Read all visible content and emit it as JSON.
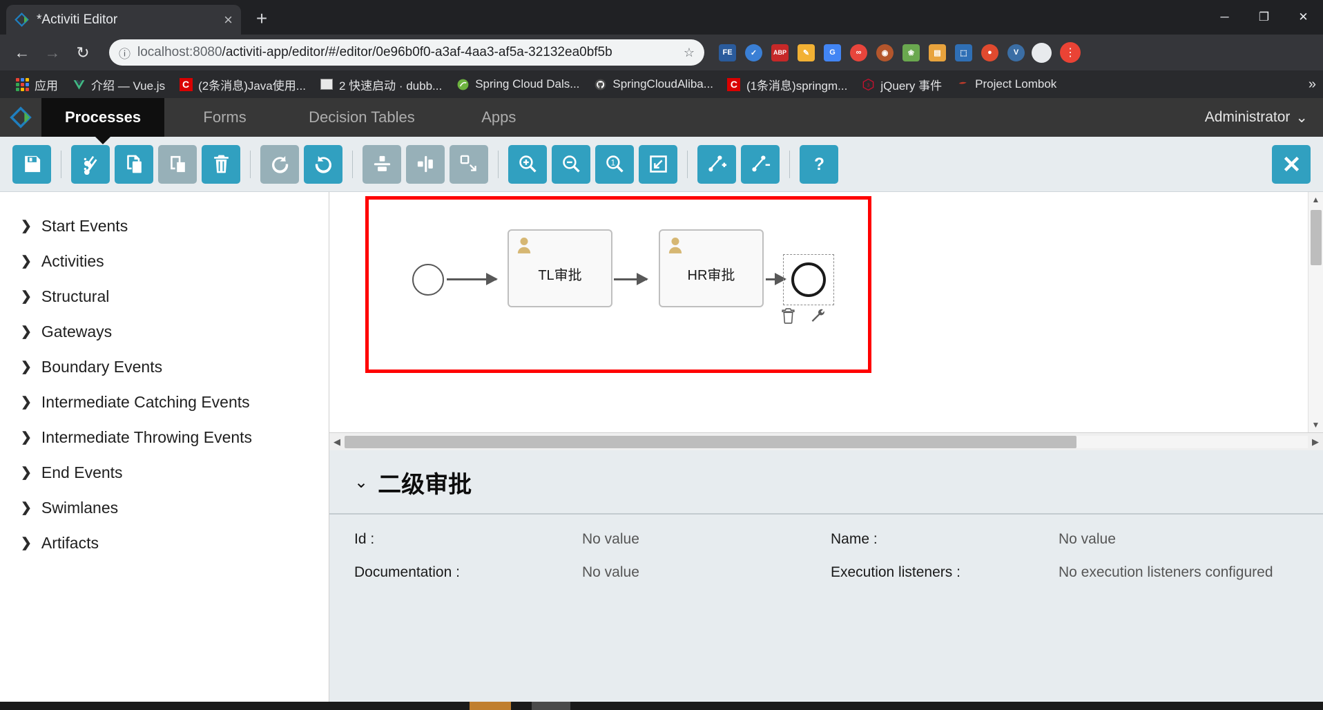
{
  "browser": {
    "tab": {
      "title": "*Activiti Editor",
      "favicon": "activiti-diamond-icon",
      "close": "×"
    },
    "newtab_label": "+",
    "window_controls": {
      "minimize": "─",
      "maximize": "❐",
      "close": "✕"
    },
    "nav": {
      "back": "←",
      "forward": "→",
      "reload": "↻"
    },
    "omnibox": {
      "info_icon": "ⓘ",
      "url_host": "localhost:8080",
      "url_path": "/activiti-app/editor/#/editor/0e96b0f0-a3af-4aa3-af5a-32132ea0bf5b",
      "star": "☆"
    },
    "extensions": [
      {
        "name": "fe-extension",
        "label": "FE",
        "color": "#2a5b9c"
      },
      {
        "name": "check-extension",
        "label": "✓",
        "color": "#3a7fd5"
      },
      {
        "name": "adblock-plus-extension",
        "label": "ABP",
        "color": "#c62828"
      },
      {
        "name": "notes-extension",
        "label": "✎",
        "color": "#f2b134"
      },
      {
        "name": "google-translate-extension",
        "label": "G",
        "color": "#4285f4"
      },
      {
        "name": "infinity-extension",
        "label": "∞",
        "color": "#e8453c"
      },
      {
        "name": "monkey-extension",
        "label": "◉",
        "color": "#b4562c"
      },
      {
        "name": "leaf-extension",
        "label": "❀",
        "color": "#6aa84f"
      },
      {
        "name": "box-extension",
        "label": "▤",
        "color": "#e8a33d"
      },
      {
        "name": "dashboard-extension",
        "label": "⬚",
        "color": "#2f6fb5"
      },
      {
        "name": "circle-extension",
        "label": "●",
        "color": "#e04a2f"
      },
      {
        "name": "v-extension",
        "label": "V",
        "color": "#3b6ea5"
      }
    ],
    "bookmarks": [
      {
        "label": "应用",
        "icon": "apps-grid-icon"
      },
      {
        "label": "介绍 — Vue.js",
        "icon": "vue-icon"
      },
      {
        "label": "(2条消息)Java使用...",
        "icon": "csdn-icon"
      },
      {
        "label": "2 快速启动 · dubb...",
        "icon": "book-icon"
      },
      {
        "label": "Spring Cloud Dals...",
        "icon": "spring-icon"
      },
      {
        "label": "SpringCloudAliba...",
        "icon": "github-icon"
      },
      {
        "label": "(1条消息)springm...",
        "icon": "csdn-icon"
      },
      {
        "label": "jQuery 事件",
        "icon": "jquery-icon"
      },
      {
        "label": "Project Lombok",
        "icon": "lombok-icon"
      }
    ],
    "bookmarks_overflow": "»"
  },
  "app": {
    "brand_icon": "activiti-logo-icon",
    "tabs": [
      {
        "label": "Processes",
        "active": true
      },
      {
        "label": "Forms",
        "active": false
      },
      {
        "label": "Decision Tables",
        "active": false
      },
      {
        "label": "Apps",
        "active": false
      }
    ],
    "user_menu": {
      "label": "Administrator",
      "chevron": "⌄"
    }
  },
  "toolbar": {
    "buttons": [
      {
        "name": "save-button",
        "icon": "save-icon",
        "enabled": true
      },
      {
        "sep": true
      },
      {
        "name": "cut-button",
        "icon": "cut-icon",
        "enabled": true
      },
      {
        "name": "copy-button",
        "icon": "copy-icon",
        "enabled": true
      },
      {
        "name": "paste-button",
        "icon": "paste-icon",
        "enabled": false
      },
      {
        "name": "delete-button",
        "icon": "trash-icon",
        "enabled": true
      },
      {
        "sep": true
      },
      {
        "name": "redo-button",
        "icon": "redo-icon",
        "enabled": false
      },
      {
        "name": "undo-button",
        "icon": "undo-icon",
        "enabled": true
      },
      {
        "sep": true
      },
      {
        "name": "align-vertical-button",
        "icon": "align-vertical-icon",
        "enabled": false
      },
      {
        "name": "align-horizontal-button",
        "icon": "align-horizontal-icon",
        "enabled": false
      },
      {
        "name": "same-size-button",
        "icon": "resize-icon",
        "enabled": false
      },
      {
        "sep": true
      },
      {
        "name": "zoom-in-button",
        "icon": "zoom-in-icon",
        "enabled": true
      },
      {
        "name": "zoom-out-button",
        "icon": "zoom-out-icon",
        "enabled": true
      },
      {
        "name": "zoom-actual-button",
        "icon": "zoom-actual-icon",
        "enabled": true
      },
      {
        "name": "zoom-fit-button",
        "icon": "zoom-fit-icon",
        "enabled": true
      },
      {
        "sep": true
      },
      {
        "name": "add-bendpoint-button",
        "icon": "bendpoint-add-icon",
        "enabled": true
      },
      {
        "name": "remove-bendpoint-button",
        "icon": "bendpoint-remove-icon",
        "enabled": true
      },
      {
        "sep": true
      },
      {
        "name": "help-button",
        "icon": "help-icon",
        "enabled": true
      }
    ],
    "close_label": "✕",
    "accent_color": "#31a0c0",
    "disabled_color": "#97b0b8"
  },
  "palette": {
    "items": [
      {
        "label": "Start Events"
      },
      {
        "label": "Activities"
      },
      {
        "label": "Structural"
      },
      {
        "label": "Gateways"
      },
      {
        "label": "Boundary Events"
      },
      {
        "label": "Intermediate Catching Events"
      },
      {
        "label": "Intermediate Throwing Events"
      },
      {
        "label": "End Events"
      },
      {
        "label": "Swimlanes"
      },
      {
        "label": "Artifacts"
      }
    ],
    "chevron": "❯"
  },
  "canvas": {
    "selection_color": "#ff0000",
    "nodes": [
      {
        "name": "start-event",
        "type": "startEvent",
        "label": ""
      },
      {
        "name": "user-task-tl",
        "type": "userTask",
        "label": "TL审批"
      },
      {
        "name": "user-task-hr",
        "type": "userTask",
        "label": "HR审批"
      },
      {
        "name": "end-event",
        "type": "endEvent",
        "label": "",
        "selected": true
      }
    ],
    "element_actions": [
      {
        "name": "delete-element-icon"
      },
      {
        "name": "morph-element-icon"
      }
    ],
    "hscroll": {
      "left_arrow": "◀",
      "right_arrow": "▶"
    },
    "vscroll": {
      "up_arrow": "▲",
      "down_arrow": "▼"
    }
  },
  "properties": {
    "chevron": "⌄",
    "title": "二级审批",
    "rows": [
      {
        "label": "Id :",
        "value": "No value",
        "label2": "Name :",
        "value2": "No value"
      },
      {
        "label": "Documentation :",
        "value": "No value",
        "label2": "Execution listeners :",
        "value2": "No execution listeners configured"
      }
    ]
  }
}
